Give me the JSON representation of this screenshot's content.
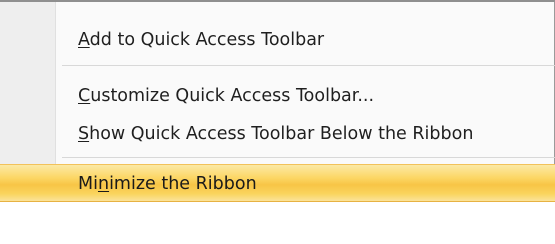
{
  "menu": {
    "items": [
      {
        "accel": "A",
        "rest": "dd to Quick Access Toolbar"
      },
      {
        "accel": "C",
        "rest": "ustomize Quick Access Toolbar..."
      },
      {
        "accel": "S",
        "rest": "how Quick Access Toolbar Below the Ribbon"
      },
      {
        "pre": "Mi",
        "accel": "n",
        "rest": "imize the Ribbon"
      }
    ],
    "highlight_color": "#f8c546"
  }
}
